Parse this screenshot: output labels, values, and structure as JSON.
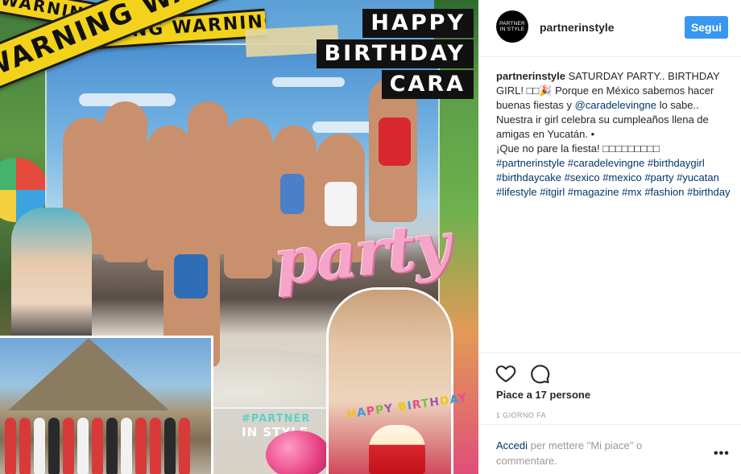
{
  "post_image": {
    "warning_tape_text": "WARNING WARNING WARNING",
    "warning_tape_text_short": "WARNING WARNING",
    "title_lines": [
      "HAPPY",
      "BIRTHDAY",
      "CARA"
    ],
    "watermark_line1": "#PARTNER",
    "watermark_line2": "IN STYLE",
    "party_word": "party",
    "candles_text": "HAPPY BIRTHDAY"
  },
  "header": {
    "avatar_line1": "PARTNER",
    "avatar_line2": "IN STYLE",
    "username": "partnerinstyle",
    "follow_label": "Segui"
  },
  "caption": {
    "username": "partnerinstyle",
    "text_1": "SATURDAY PARTY.. BIRTHDAY GIRL! □□🎉 Porque en México sabemos hacer buenas fiestas y",
    "mention": "@caradelevingne",
    "text_2": "lo sabe.. Nuestra ir girl celebra su cumpleaños llena de amigas en Yucatán. •",
    "text_3": "¡Que no pare la fiesta! □□□□□□□□□",
    "hashtags": [
      "#partnerinstyle",
      "#caradelevingne",
      "#birthdaygirl",
      "#birthdaycake",
      "#sexico",
      "#mexico",
      "#party",
      "#yucatan",
      "#lifestyle",
      "#itgirl",
      "#magazine",
      "#mx",
      "#fashion",
      "#birthday"
    ]
  },
  "actions": {
    "like_icon": "heart-icon",
    "comment_icon": "comment-icon",
    "likes_text": "Piace a 17 persone",
    "timestamp": "1 GIORNO FA"
  },
  "comment_box": {
    "login_link": "Accedi",
    "prompt": " per mettere \"Mi piace\" o commentare.",
    "more_label": "•••"
  },
  "colors": {
    "follow_button": "#3897f0",
    "link": "#003569",
    "text": "#262626",
    "muted": "#999999",
    "warning_tape": "#f2d21b"
  }
}
